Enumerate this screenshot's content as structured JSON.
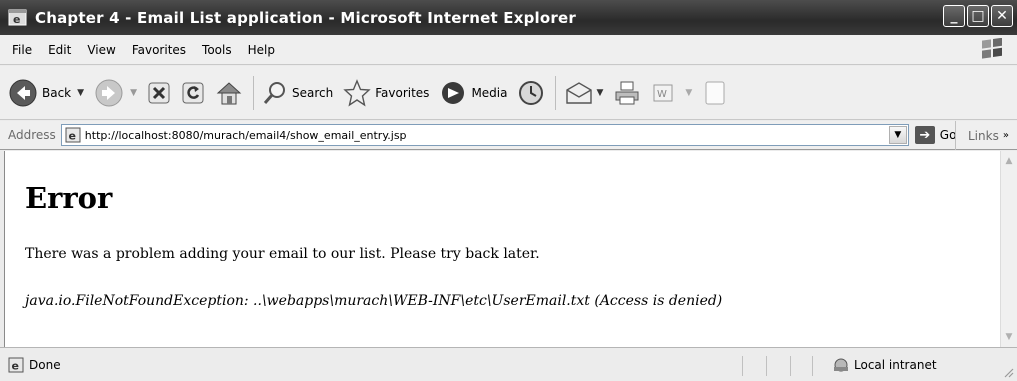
{
  "window": {
    "title": "Chapter 4 - Email List application - Microsoft Internet Explorer",
    "controls": {
      "minimize": "_",
      "maximize": "□",
      "close": "✕"
    }
  },
  "menu": {
    "items": [
      "File",
      "Edit",
      "View",
      "Favorites",
      "Tools",
      "Help"
    ]
  },
  "toolbar": {
    "back_label": "Back",
    "search_label": "Search",
    "favorites_label": "Favorites",
    "media_label": "Media"
  },
  "address": {
    "label": "Address",
    "url": "http://localhost:8080/murach/email4/show_email_entry.jsp",
    "go_label": "Go",
    "links_label": "Links"
  },
  "page": {
    "heading": "Error",
    "message": "There was a problem adding your email to our list. Please try back later.",
    "exception": "java.io.FileNotFoundException: ..\\webapps\\murach\\WEB-INF\\etc\\UserEmail.txt (Access is denied)"
  },
  "status": {
    "text": "Done",
    "zone": "Local intranet"
  },
  "colors": {
    "titlebar": "#3a3a3a",
    "chrome": "#efefef"
  }
}
